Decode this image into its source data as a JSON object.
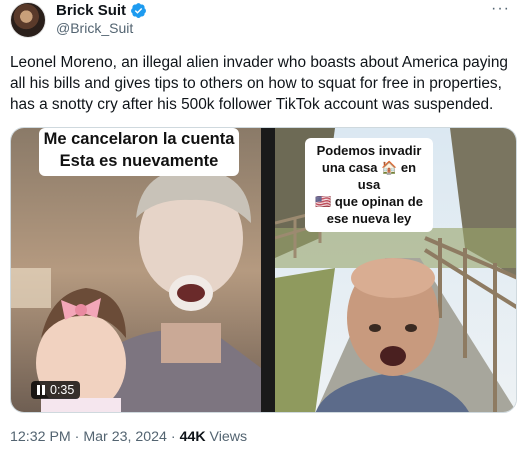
{
  "author": {
    "display_name": "Brick Suit",
    "handle": "@Brick_Suit",
    "verified": true
  },
  "menu": {
    "more_label": "···"
  },
  "tweet": {
    "text": "Leonel Moreno, an illegal alien invader who boasts about America paying all his bills and gives tips to others on how to squat for free in properties, has a snotty cry after his 500k follower TikTok account was suspended."
  },
  "media": {
    "left": {
      "caption_line1": "Me cancelaron la cuenta",
      "caption_line2": "Esta es nuevamente",
      "duration": "0:35"
    },
    "right": {
      "caption_line1": "Podemos invadir",
      "caption_line2": "una casa 🏠 en usa",
      "caption_line3": "🇺🇸 que opinan de",
      "caption_line4": "ese nueva ley"
    }
  },
  "meta": {
    "time": "12:32 PM",
    "separator": " · ",
    "date": "Mar 23, 2024",
    "views_count": "44K",
    "views_label": " Views"
  },
  "colors": {
    "verified": "#1d9bf0",
    "text_primary": "#0f1419",
    "text_secondary": "#536471"
  }
}
